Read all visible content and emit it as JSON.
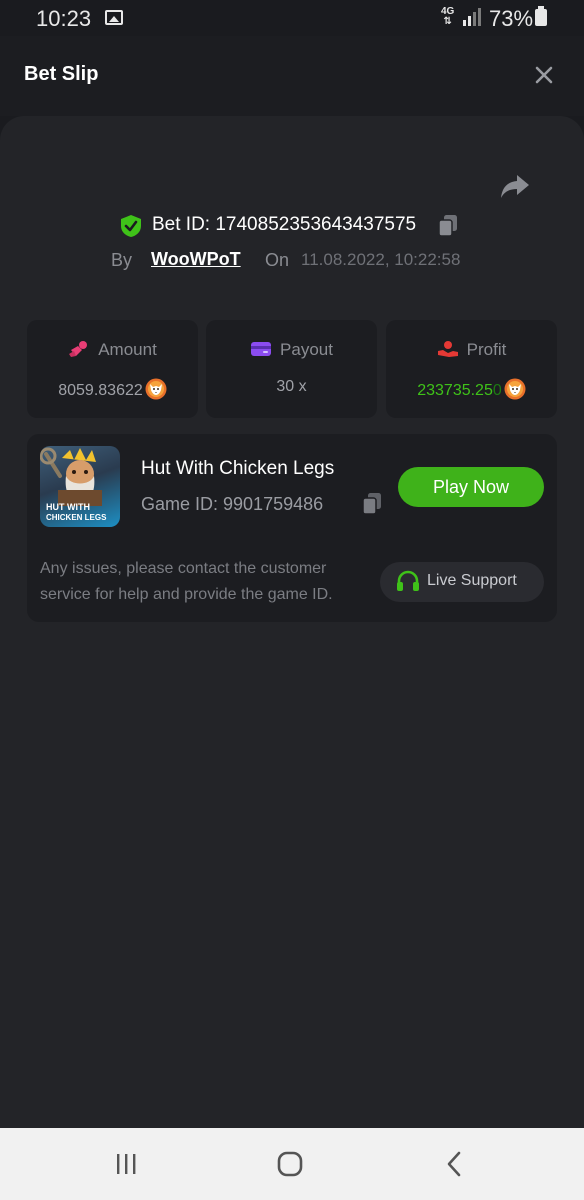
{
  "status_bar": {
    "time": "10:23",
    "network": "4G",
    "battery": "73%"
  },
  "header": {
    "title": "Bet Slip"
  },
  "bet": {
    "id_label": "Bet ID: 1740852353643437575",
    "by_label": "By",
    "user": "WooWPoT",
    "on_label": "On",
    "datetime": "11.08.2022, 10:22:58"
  },
  "stats": {
    "amount_label": "Amount",
    "amount_value": "8059.83622",
    "payout_label": "Payout",
    "payout_value": "30 x",
    "profit_label": "Profit",
    "profit_value_main": "233735.25",
    "profit_value_tail": "0"
  },
  "game": {
    "thumb_text_line1": "HUT WITH",
    "thumb_text_line2": "CHICKEN LEGS",
    "title": "Hut With Chicken Legs",
    "id_label": "Game ID: 9901759486",
    "play_label": "Play Now",
    "issue_text": "Any issues, please contact the customer service for help and provide the game ID.",
    "support_label": "Live Support"
  },
  "colors": {
    "background": "#1a1b1f",
    "panel": "#232428",
    "card": "#1c1d21",
    "accent_green": "#3fb21a",
    "shield_green": "#3fc219",
    "amount_icon": "#e83e76",
    "payout_icon": "#8b4cf0",
    "profit_icon": "#e53935"
  },
  "icons": {
    "close": "close-icon",
    "share": "share-icon",
    "shield": "shield-check-icon",
    "copy": "copy-icon",
    "amount": "coins-icon",
    "payout": "card-icon",
    "profit": "hand-coin-icon",
    "coin": "shiba-coin-icon",
    "support": "headset-icon"
  }
}
